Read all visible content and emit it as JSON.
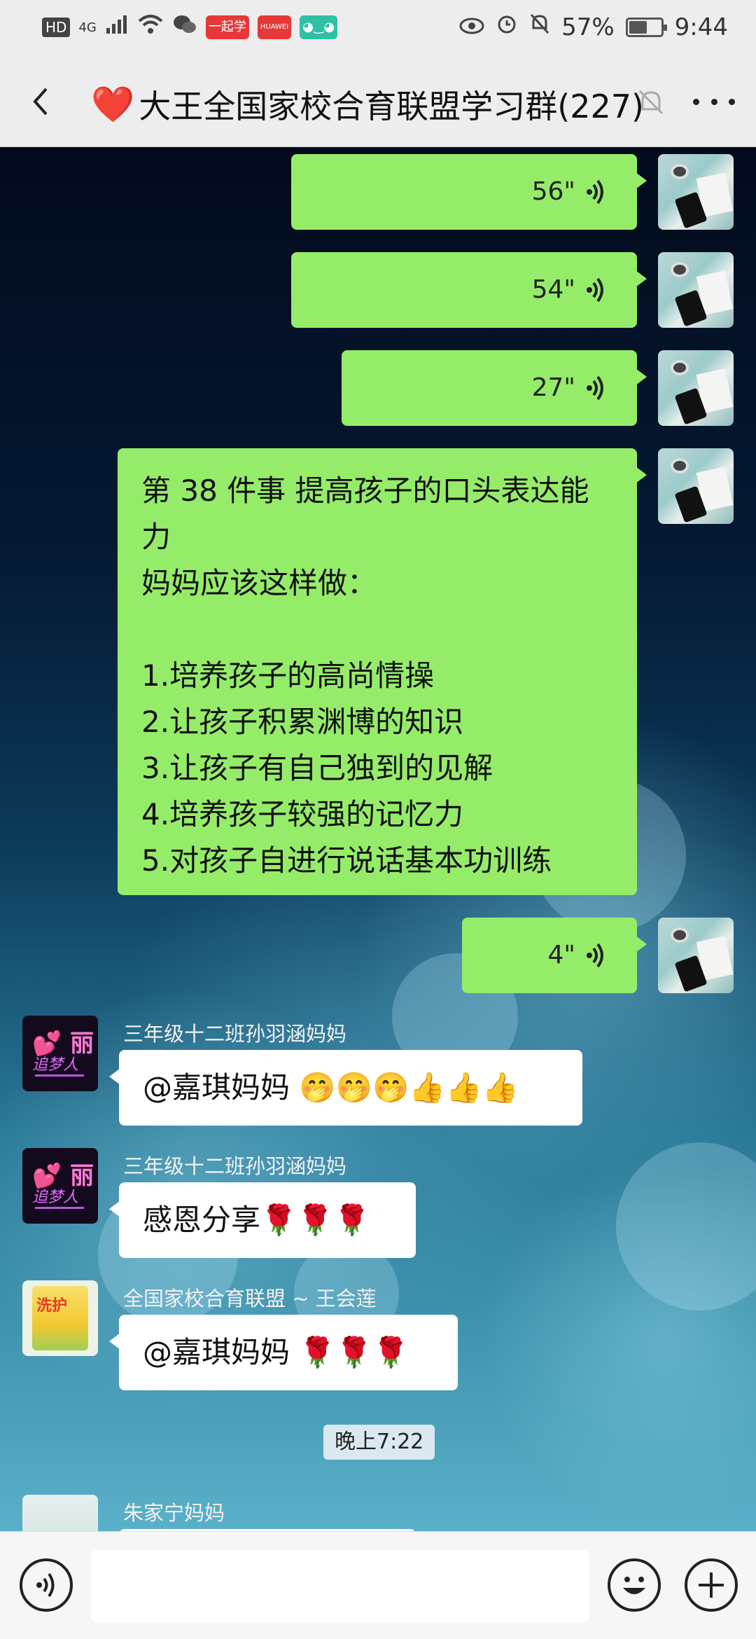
{
  "status_bar": {
    "network": "HD",
    "signal_type": "4G",
    "app_badge_1": "一起学",
    "app_badge_2": "HUAWEI",
    "battery": "57%",
    "battery_level": 0.57,
    "time": "9:44"
  },
  "header": {
    "title": "大王全国家校合育联盟学习群(227)",
    "title_icon": "❤️",
    "muted": true
  },
  "messages": [
    {
      "type": "voice",
      "direction": "out",
      "duration": "56\""
    },
    {
      "type": "voice",
      "direction": "out",
      "duration": "54\""
    },
    {
      "type": "voice",
      "direction": "out",
      "duration": "27\""
    },
    {
      "type": "text",
      "direction": "out",
      "lines": [
        "第 38 件事  提高孩子的口头表达能",
        "力",
        "妈妈应该这样做：",
        "",
        "1.培养孩子的高尚情操",
        "2.让孩子积累渊博的知识",
        "3.让孩子有自己独到的见解",
        "4.培养孩子较强的记忆力",
        "5.对孩子自进行说话基本功训练"
      ]
    },
    {
      "type": "voice",
      "direction": "out",
      "duration": "4\""
    },
    {
      "type": "text",
      "direction": "in",
      "sender": "三年级十二班孙羽涵妈妈",
      "text": "@嘉琪妈妈 🤭🤭🤭👍👍👍"
    },
    {
      "type": "text",
      "direction": "in",
      "sender": "三年级十二班孙羽涵妈妈",
      "text": "感恩分享🌹🌹🌹"
    },
    {
      "type": "text",
      "direction": "in",
      "sender": "全国家校合育联盟 ~ 王会莲",
      "text": "@嘉琪妈妈 🌹🌹🌹"
    },
    {
      "type": "timestamp",
      "text": "晚上7:22"
    },
    {
      "type": "text",
      "direction": "in",
      "sender": "朱家宁妈妈",
      "text": ""
    }
  ],
  "avatars": {
    "neon_line1": "💕 丽",
    "neon_line2": "追梦人",
    "bag_label": "洗护"
  },
  "input": {
    "value": ""
  }
}
